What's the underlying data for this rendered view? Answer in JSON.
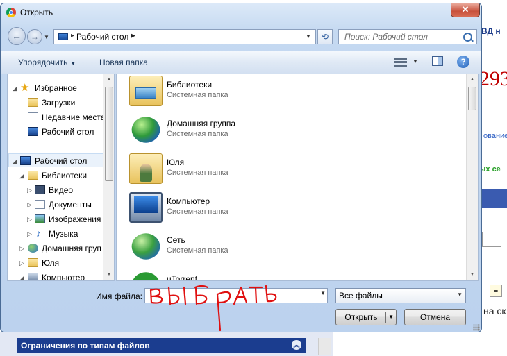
{
  "dialog": {
    "title": "Открыть",
    "close_glyph": "✕"
  },
  "address": {
    "location": "Рабочий стол",
    "search_placeholder": "Поиск: Рабочий стол"
  },
  "toolbar": {
    "organize_label": "Упорядочить",
    "new_folder_label": "Новая папка"
  },
  "nav_pane": {
    "items": [
      {
        "label": "Избранное",
        "icon": "star-icon",
        "level": 0
      },
      {
        "label": "Загрузки",
        "icon": "downloads-icon",
        "level": 1
      },
      {
        "label": "Недавние места",
        "icon": "recent-places-icon",
        "level": 1
      },
      {
        "label": "Рабочий стол",
        "icon": "desktop-icon",
        "level": 1
      },
      {
        "label": "Рабочий стол",
        "icon": "desktop-icon",
        "level": 0,
        "selected": true
      },
      {
        "label": "Библиотеки",
        "icon": "libraries-icon",
        "level": 1
      },
      {
        "label": "Видео",
        "icon": "video-icon",
        "level": 2
      },
      {
        "label": "Документы",
        "icon": "documents-icon",
        "level": 2
      },
      {
        "label": "Изображения",
        "icon": "pictures-icon",
        "level": 2
      },
      {
        "label": "Музыка",
        "icon": "music-icon",
        "level": 2
      },
      {
        "label": "Домашняя груп",
        "icon": "homegroup-icon",
        "level": 1
      },
      {
        "label": "Юля",
        "icon": "user-folder-icon",
        "level": 1
      },
      {
        "label": "Компьютер",
        "icon": "computer-icon",
        "level": 1
      }
    ]
  },
  "file_list": {
    "items": [
      {
        "name": "Библиотеки",
        "desc": "Системная папка",
        "icon": "libraries-icon"
      },
      {
        "name": "Домашняя группа",
        "desc": "Системная папка",
        "icon": "homegroup-icon"
      },
      {
        "name": "Юля",
        "desc": "Системная папка",
        "icon": "user-folder-icon"
      },
      {
        "name": "Компьютер",
        "desc": "Системная папка",
        "icon": "computer-icon"
      },
      {
        "name": "Сеть",
        "desc": "Системная папка",
        "icon": "network-icon"
      },
      {
        "name": "uTorrent",
        "desc": "",
        "icon": "utorrent-icon"
      }
    ]
  },
  "bottom": {
    "filename_label": "Имя файла:",
    "filename_value": "",
    "filetype_value": "Все файлы",
    "open_label": "Открыть",
    "cancel_label": "Отмена"
  },
  "annotation": {
    "handwritten_text": "ВЫБРАТЬ",
    "color": "#e01010"
  },
  "background_page": {
    "header_fragment": "ВД н",
    "number_fragment": "293",
    "link_fragment": "ование",
    "green_fragment": "ых се",
    "text_fragment": "на ск",
    "panel_title": "Ограничения по типам файлов"
  }
}
